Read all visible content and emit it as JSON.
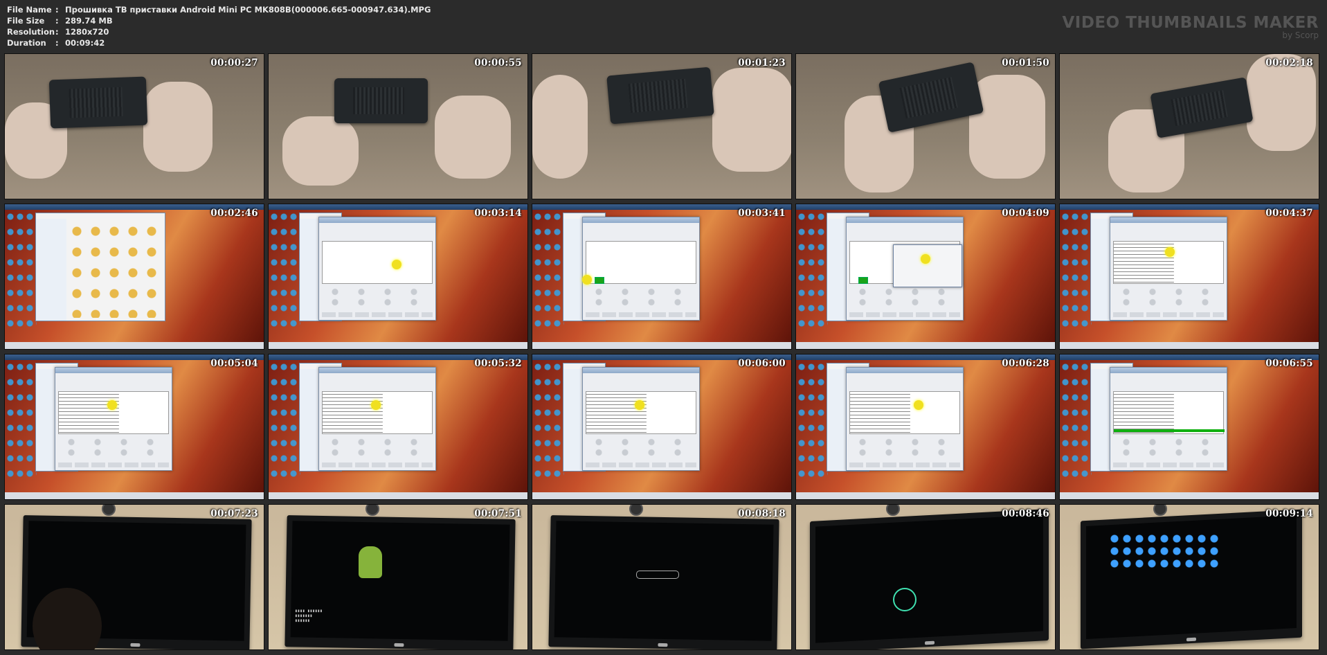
{
  "meta": {
    "file_name_label": "File Name",
    "file_name": "Прошивка ТВ приставки Android Mini PC MK808B(000006.665-000947.634).MPG",
    "file_size_label": "File Size",
    "file_size": "289.74 MB",
    "resolution_label": "Resolution",
    "resolution": "1280x720",
    "duration_label": "Duration",
    "duration": "00:09:42"
  },
  "brand": {
    "title": "VIDEO THUMBNAILS MAKER",
    "subtitle": "by Scorp"
  },
  "thumbnails": [
    {
      "time": "00:00:27",
      "scene": "hands"
    },
    {
      "time": "00:00:55",
      "scene": "hands"
    },
    {
      "time": "00:01:23",
      "scene": "hands"
    },
    {
      "time": "00:01:50",
      "scene": "hands"
    },
    {
      "time": "00:02:18",
      "scene": "hands"
    },
    {
      "time": "00:02:46",
      "scene": "desktop-explorer"
    },
    {
      "time": "00:03:14",
      "scene": "desktop-dialog"
    },
    {
      "time": "00:03:41",
      "scene": "desktop-dialog-device"
    },
    {
      "time": "00:04:09",
      "scene": "desktop-file-open"
    },
    {
      "time": "00:04:37",
      "scene": "desktop-dialog-log"
    },
    {
      "time": "00:05:04",
      "scene": "desktop-dialog-log"
    },
    {
      "time": "00:05:32",
      "scene": "desktop-dialog-log"
    },
    {
      "time": "00:06:00",
      "scene": "desktop-dialog-log"
    },
    {
      "time": "00:06:28",
      "scene": "desktop-dialog-log"
    },
    {
      "time": "00:06:55",
      "scene": "desktop-dialog-progress"
    },
    {
      "time": "00:07:23",
      "scene": "tv-off"
    },
    {
      "time": "00:07:51",
      "scene": "tv-android-recovery"
    },
    {
      "time": "00:08:18",
      "scene": "tv-android-boot"
    },
    {
      "time": "00:08:46",
      "scene": "tv-welcome"
    },
    {
      "time": "00:09:14",
      "scene": "tv-homescreen"
    }
  ]
}
